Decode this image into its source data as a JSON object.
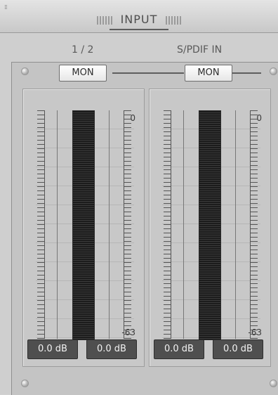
{
  "header": {
    "title": "INPUT"
  },
  "channels": [
    {
      "label": "1 / 2",
      "mon_label": "MON",
      "scale_top": "0",
      "scale_bottom": "-63",
      "displays": [
        "0.0 dB",
        "0.0 dB"
      ]
    },
    {
      "label": "S/PDIF IN",
      "mon_label": "MON",
      "scale_top": "0",
      "scale_bottom": "-63",
      "displays": [
        "0.0 dB",
        "0.0 dB"
      ]
    }
  ],
  "colors": {
    "panel": "#c4c4c4",
    "display_bg": "#4f4f4f",
    "meter_led": "#1c1c1c"
  }
}
